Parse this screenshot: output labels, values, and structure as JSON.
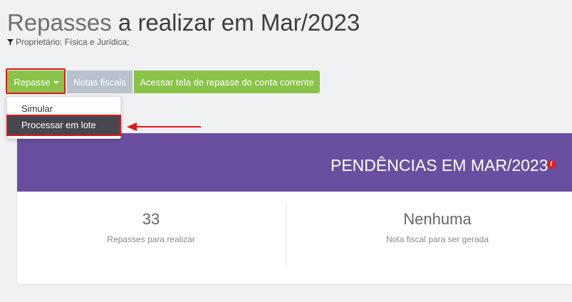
{
  "header": {
    "title_light": "Repasses",
    "title_rest": " a realizar em Mar/2023",
    "filter_text": "Proprietário: Física e Jurídica;",
    "filter_icon": "filter-icon"
  },
  "toolbar": {
    "repasse_label": "Repasse",
    "notas_label": "Notas fiscais",
    "acessar_label": "Acessar tela de repasse do conta corrente"
  },
  "dropdown": {
    "items": [
      {
        "label": "Simular"
      },
      {
        "label": "Processar em lote"
      }
    ]
  },
  "card": {
    "title": "PENDÊNCIAS EM MAR/2023",
    "info_icon": "i",
    "stats": [
      {
        "value": "33",
        "label": "Repasses para realizar"
      },
      {
        "value": "Nenhuma",
        "label": "Nota fiscal para ser gerada"
      }
    ]
  },
  "colors": {
    "accent_green": "#8bc34a",
    "header_purple": "#6a4fa0",
    "highlight_red": "#e01818"
  }
}
